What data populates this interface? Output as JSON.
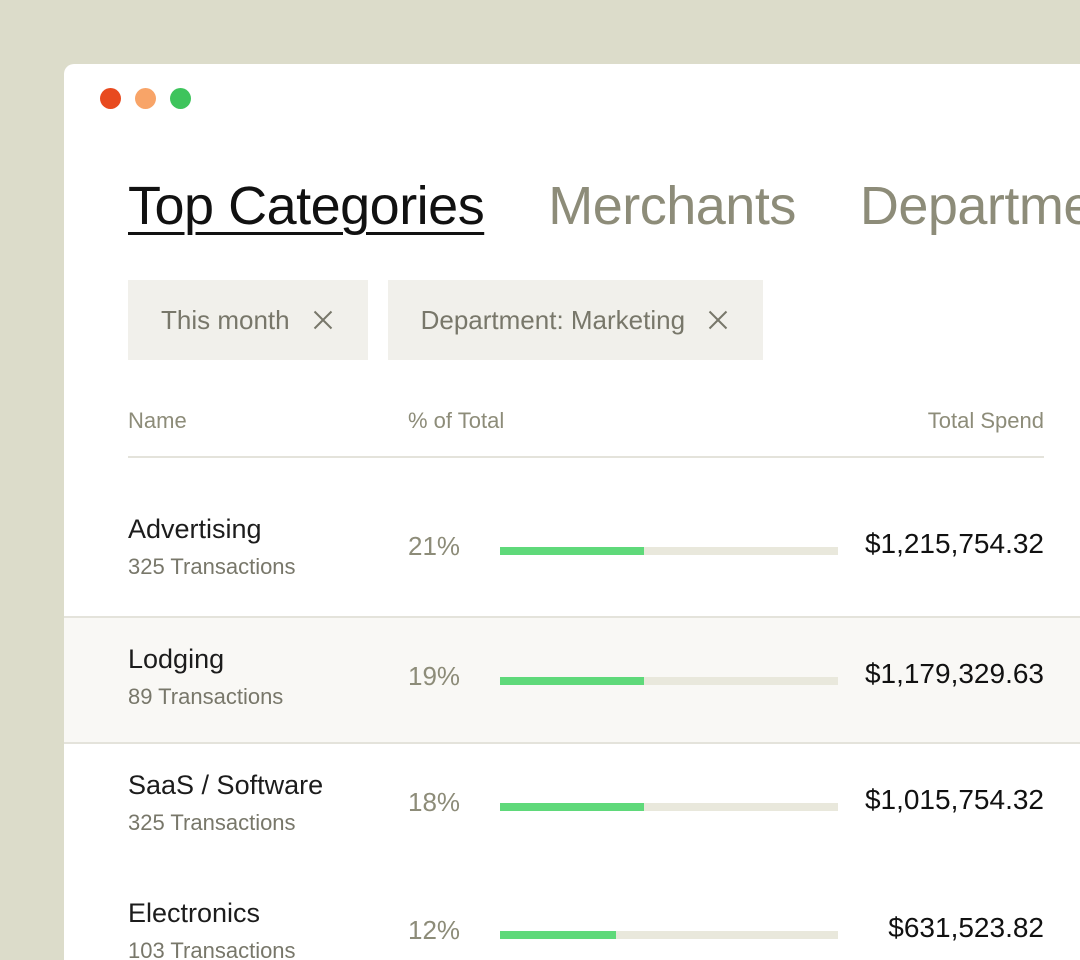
{
  "window": {
    "traffic_lights": [
      "close",
      "minimize",
      "maximize"
    ]
  },
  "tabs": [
    {
      "label": "Top Categories",
      "active": true
    },
    {
      "label": "Merchants",
      "active": false
    },
    {
      "label": "Departments",
      "active": false
    }
  ],
  "filters": [
    {
      "label": "This month",
      "icon": "close-icon"
    },
    {
      "label": "Department: Marketing",
      "icon": "close-icon"
    }
  ],
  "table": {
    "headers": {
      "name": "Name",
      "percent": "% of Total",
      "spend": "Total Spend"
    },
    "rows": [
      {
        "name": "Advertising",
        "transactions": "325 Transactions",
        "percent": "21%",
        "bar_fraction": 0.425,
        "spend": "$1,215,754.32",
        "highlighted": false
      },
      {
        "name": "Lodging",
        "transactions": "89 Transactions",
        "percent": "19%",
        "bar_fraction": 0.425,
        "spend": "$1,179,329.63",
        "highlighted": true
      },
      {
        "name": "SaaS / Software",
        "transactions": "325 Transactions",
        "percent": "18%",
        "bar_fraction": 0.425,
        "spend": "$1,015,754.32",
        "highlighted": false
      },
      {
        "name": "Electronics",
        "transactions": "103 Transactions",
        "percent": "12%",
        "bar_fraction": 0.343,
        "spend": "$631,523.82",
        "highlighted": false
      }
    ]
  },
  "colors": {
    "background": "#dcdcca",
    "bar_fill": "#5fd97a",
    "bar_track": "#e9e8dc",
    "traffic_red": "#e84a1f",
    "traffic_orange": "#f8a468",
    "traffic_green": "#3ec45c"
  }
}
